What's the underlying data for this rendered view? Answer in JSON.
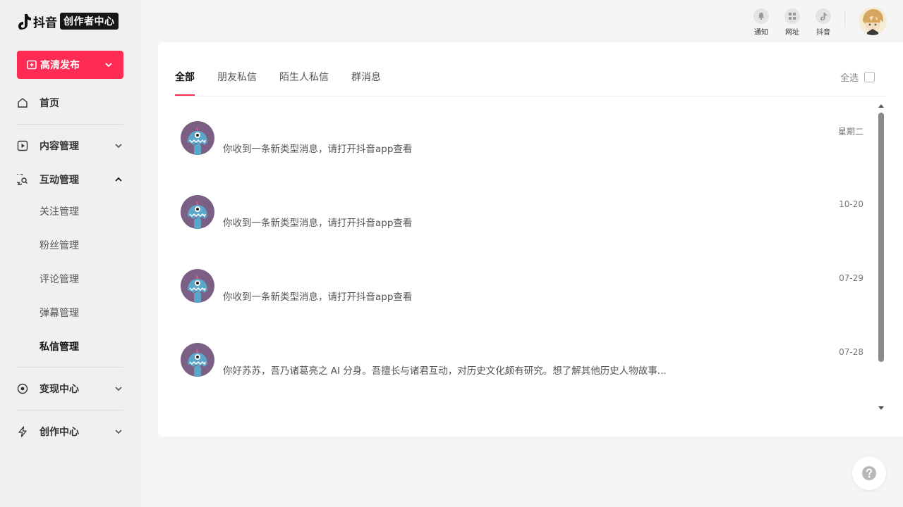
{
  "brand": {
    "logo_text": "抖音",
    "badge": "创作者中心"
  },
  "publish": {
    "label": "高清发布"
  },
  "nav": {
    "home": "首页",
    "content": "内容管理",
    "interaction": "互动管理",
    "sub": [
      "关注管理",
      "粉丝管理",
      "评论管理",
      "弹幕管理",
      "私信管理"
    ],
    "monetize": "变现中心",
    "create": "创作中心"
  },
  "top_bar": {
    "notify": "通知",
    "site": "网址",
    "douyin": "抖音"
  },
  "tabs": [
    "全部",
    "朋友私信",
    "陌生人私信",
    "群消息"
  ],
  "select_all": "全选",
  "messages": [
    {
      "text": "你收到一条新类型消息，请打开抖音app查看",
      "date": "星期二"
    },
    {
      "text": "你收到一条新类型消息，请打开抖音app查看",
      "date": "10-20"
    },
    {
      "text": "你收到一条新类型消息，请打开抖音app查看",
      "date": "07-29"
    },
    {
      "text": "你好苏苏，吾乃诸葛亮之 AI 分身。吾擅长与诸君互动，对历史文化颇有研究。想了解其他历史人物故事...",
      "date": "07-28"
    }
  ],
  "colors": {
    "accent": "#fe2c55",
    "sidebar_bg": "#f0f0f2",
    "avatar_bg": "#7b5f84",
    "avatar_face": "#5aa7c9"
  },
  "icons": {
    "help": "question-icon"
  }
}
